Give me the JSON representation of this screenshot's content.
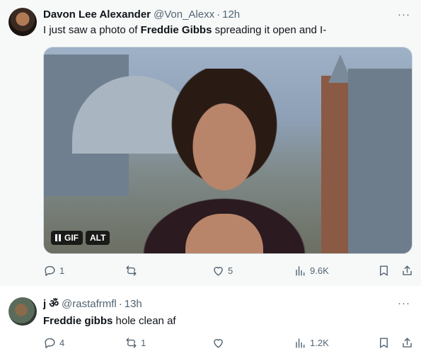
{
  "tweets": [
    {
      "name": "Davon Lee Alexander",
      "handle": "@Von_Alexx",
      "sep": "·",
      "time": "12h",
      "text_before": "I just saw a photo of ",
      "text_bold": "Freddie Gibbs",
      "text_after": " spreading it open and I-",
      "media_badges": {
        "gif": "GIF",
        "alt": "ALT"
      },
      "stats": {
        "replies": "1",
        "reposts": "",
        "likes": "5",
        "views": "9.6K"
      }
    },
    {
      "name": "j ॐ",
      "handle": "@rastafrmfl",
      "sep": "·",
      "time": "13h",
      "text_before": "",
      "text_bold": "Freddie gibbs",
      "text_after": " hole clean af",
      "stats": {
        "replies": "4",
        "reposts": "1",
        "likes": "",
        "views": "1.2K"
      }
    }
  ],
  "more_label": "···",
  "colors": {
    "text": "#0f1419",
    "muted": "#536471",
    "bg_main": "#f7f9f9",
    "bg_reply": "#ffffff"
  }
}
